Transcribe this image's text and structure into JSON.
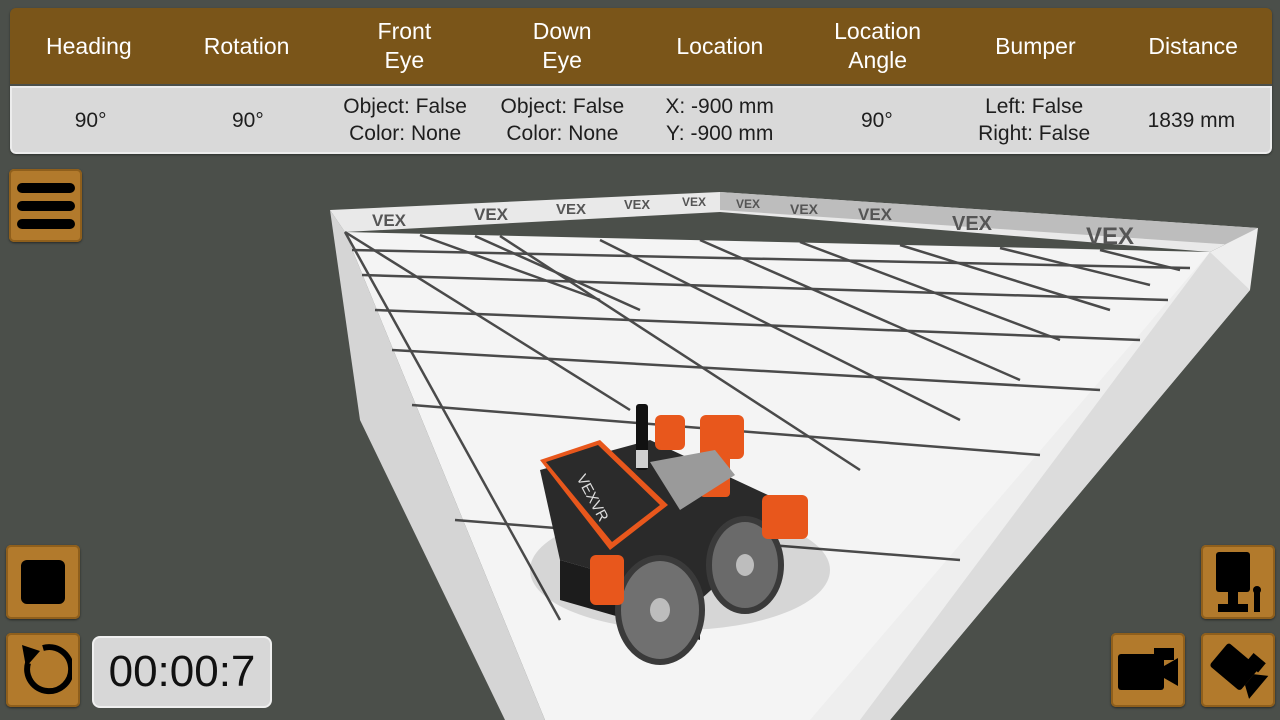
{
  "telemetry": {
    "headers": {
      "heading": "Heading",
      "rotation": "Rotation",
      "front_eye_1": "Front",
      "front_eye_2": "Eye",
      "down_eye_1": "Down",
      "down_eye_2": "Eye",
      "location": "Location",
      "location_angle_1": "Location",
      "location_angle_2": "Angle",
      "bumper": "Bumper",
      "distance": "Distance"
    },
    "values": {
      "heading": "90°",
      "rotation": "90°",
      "front_eye_object": "Object: False",
      "front_eye_color": "Color: None",
      "down_eye_object": "Object: False",
      "down_eye_color": "Color: None",
      "location_x": "X: -900 mm",
      "location_y": "Y: -900 mm",
      "location_angle": "90°",
      "bumper_left": "Left: False",
      "bumper_right": "Right: False",
      "distance": "1839 mm"
    }
  },
  "timer": {
    "value": "00:00:7"
  },
  "playground": {
    "wall_logo": "VEX",
    "robot_label": "VEXVR"
  },
  "icons": {
    "menu": "hamburger-menu-icon",
    "stop": "stop-square-icon",
    "reset": "reset-arrow-icon",
    "top_camera": "top-camera-icon",
    "side_camera": "side-camera-icon",
    "follow_camera": "follow-camera-icon"
  },
  "colors": {
    "header": "#7a5519",
    "button": "#b27a2c",
    "background": "#4b4f4a",
    "robot_accent": "#e8571c"
  }
}
